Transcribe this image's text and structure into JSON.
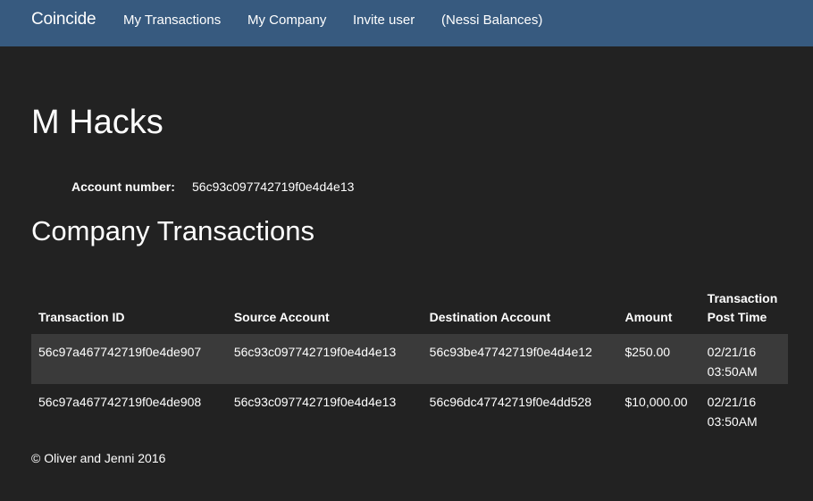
{
  "navbar": {
    "brand": "Coincide",
    "links": [
      {
        "label": "My Transactions"
      },
      {
        "label": "My Company"
      },
      {
        "label": "Invite user"
      },
      {
        "label": "(Nessi Balances)"
      }
    ],
    "background": "#375a7f"
  },
  "main": {
    "title": "M Hacks",
    "account_label": "Account number:",
    "account_number": "56c93c097742719f0e4d4e13",
    "section_title": "Company Transactions"
  },
  "table": {
    "headers": {
      "id": "Transaction ID",
      "source": "Source Account",
      "destination": "Destination Account",
      "amount": "Amount",
      "time": "Transaction Post Time"
    },
    "rows": [
      {
        "id": "56c97a467742719f0e4de907",
        "source": "56c93c097742719f0e4d4e13",
        "destination": "56c93be47742719f0e4d4e12",
        "amount": "$250.00",
        "date": "02/21/16",
        "time": "03:50AM"
      },
      {
        "id": "56c97a467742719f0e4de908",
        "source": "56c93c097742719f0e4d4e13",
        "destination": "56c96dc47742719f0e4dd528",
        "amount": "$10,000.00",
        "date": "02/21/16",
        "time": "03:50AM"
      }
    ]
  },
  "footer": {
    "text": "© Oliver and Jenni 2016"
  },
  "colors": {
    "page_background": "#222222",
    "striped_row": "#3a3a3a",
    "text": "#ffffff"
  }
}
